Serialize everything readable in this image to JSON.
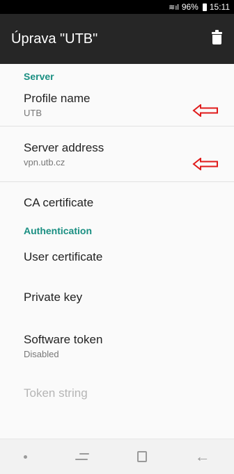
{
  "status": {
    "battery": "96%",
    "time": "15:11"
  },
  "appbar": {
    "title": "Úprava \"UTB\""
  },
  "sections": {
    "server": "Server",
    "auth": "Authentication"
  },
  "prefs": {
    "profile_name": {
      "title": "Profile name",
      "summary": "UTB"
    },
    "server_address": {
      "title": "Server address",
      "summary": "vpn.utb.cz"
    },
    "ca_certificate": {
      "title": "CA certificate"
    },
    "user_certificate": {
      "title": "User certificate"
    },
    "private_key": {
      "title": "Private key"
    },
    "software_token": {
      "title": "Software token",
      "summary": "Disabled"
    },
    "token_string": {
      "title": "Token string"
    }
  },
  "colors": {
    "accent": "#1a8f82",
    "annotation": "#e01b1b",
    "appbar": "#262626"
  }
}
